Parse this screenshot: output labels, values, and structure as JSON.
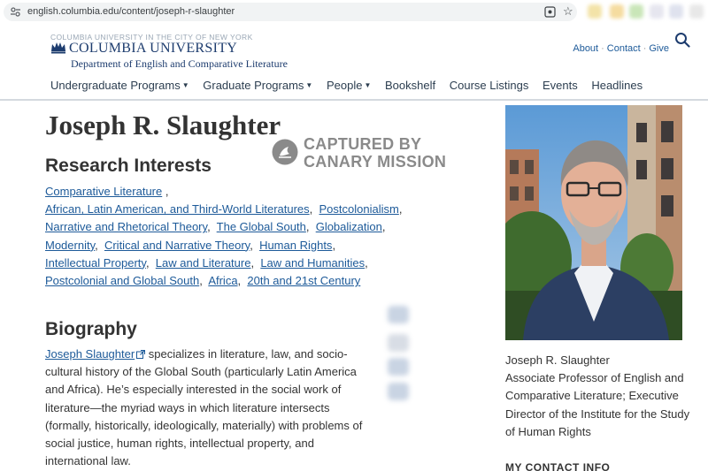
{
  "browser": {
    "url": "english.columbia.edu/content/joseph-r-slaughter"
  },
  "header": {
    "university_line": "COLUMBIA UNIVERSITY IN THE CITY OF NEW YORK",
    "university_name": "COLUMBIA UNIVERSITY",
    "department": "Department of English and Comparative Literature",
    "util_links": [
      "About",
      "Contact",
      "Give"
    ],
    "nav": [
      {
        "label": "Undergraduate Programs",
        "dropdown": true
      },
      {
        "label": "Graduate Programs",
        "dropdown": true
      },
      {
        "label": "People",
        "dropdown": true
      },
      {
        "label": "Bookshelf",
        "dropdown": false
      },
      {
        "label": "Course Listings",
        "dropdown": false
      },
      {
        "label": "Events",
        "dropdown": false
      },
      {
        "label": "Headlines",
        "dropdown": false
      }
    ]
  },
  "main": {
    "name": "Joseph R. Slaughter",
    "watermark": {
      "line1": "CAPTURED BY",
      "line2": "CANARY MISSION"
    },
    "research_heading": "Research Interests",
    "interests": [
      "Comparative Literature",
      "African, Latin American, and Third-World Literatures",
      "Postcolonialism",
      "Narrative and Rhetorical Theory",
      "The Global South",
      "Globalization",
      "Modernity",
      "Critical and Narrative Theory",
      "Human Rights",
      "Intellectual Property",
      "Law and Literature",
      "Law and Humanities",
      "Postcolonial and Global South",
      "Africa",
      "20th and 21st Century"
    ],
    "bio_heading": "Biography",
    "bio_link": "Joseph Slaughter",
    "bio_text": " specializes in literature, law, and socio-cultural history of the Global South (particularly Latin America and Africa). He’s especially interested in the social work of literature—the myriad ways in which literature intersects (formally, historically, ideologically, materially) with problems of social justice, human rights, intellectual property, and international law."
  },
  "sidebar": {
    "caption_name": "Joseph R. Slaughter",
    "caption_title": "Associate Professor of English and Comparative Literature; Executive Director of the Institute for the Study of Human Rights",
    "contact_heading": "MY CONTACT INFO"
  },
  "colors": {
    "link": "#1d5a99",
    "brand_navy": "#1d3c6e",
    "watermark_gray": "#8a8a8a"
  }
}
